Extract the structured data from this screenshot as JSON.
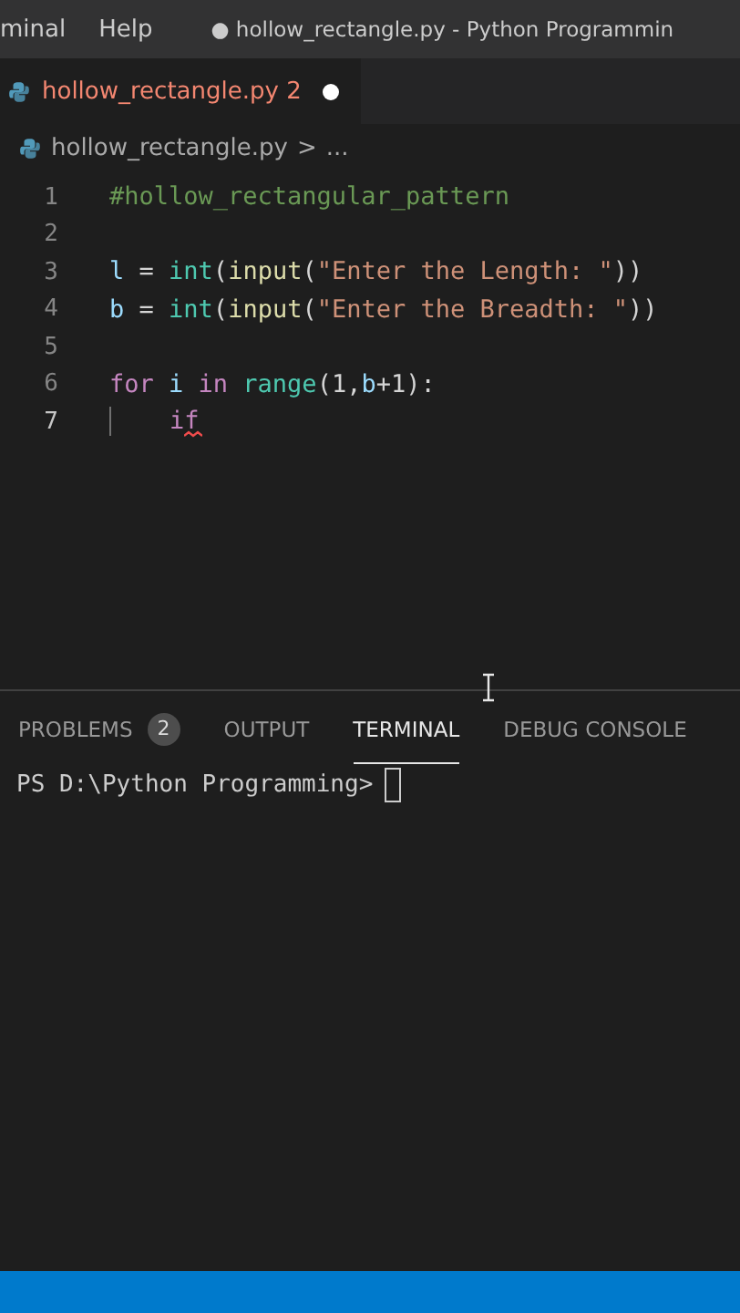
{
  "menu": [
    "minal",
    "Help"
  ],
  "window": {
    "modified_mark": "●",
    "title": "hollow_rectangle.py - Python Programmin"
  },
  "tabs": [
    {
      "label": "hollow_rectangle.py",
      "problems": "2",
      "modified": true,
      "selected": true
    }
  ],
  "breadcrumb": {
    "file": "hollow_rectangle.py",
    "separator": ">",
    "more": "..."
  },
  "code_lines": [
    {
      "number": "1",
      "tokens": [
        {
          "kind": "comment",
          "text": "#hollow_rectangular_pattern"
        }
      ]
    },
    {
      "number": "2"
    },
    {
      "number": "3",
      "tokens": [
        {
          "kind": "var",
          "text": "l"
        },
        {
          "kind": "plain",
          "text": " = "
        },
        {
          "kind": "func",
          "text": "int"
        },
        {
          "kind": "plain",
          "text": "("
        },
        {
          "kind": "builtin",
          "text": "input"
        },
        {
          "kind": "plain",
          "text": "("
        },
        {
          "kind": "string",
          "text": "\"Enter the Length: \""
        },
        {
          "kind": "plain",
          "text": "))"
        }
      ]
    },
    {
      "number": "4",
      "tokens": [
        {
          "kind": "var",
          "text": "b"
        },
        {
          "kind": "plain",
          "text": " = "
        },
        {
          "kind": "func",
          "text": "int"
        },
        {
          "kind": "plain",
          "text": "("
        },
        {
          "kind": "builtin",
          "text": "input"
        },
        {
          "kind": "plain",
          "text": "("
        },
        {
          "kind": "string",
          "text": "\"Enter the Breadth: \""
        },
        {
          "kind": "plain",
          "text": "))"
        }
      ]
    },
    {
      "number": "5"
    },
    {
      "number": "6",
      "tokens": [
        {
          "kind": "keyword",
          "text": "for"
        },
        {
          "kind": "var",
          "text": " i"
        },
        {
          "kind": "keyword",
          "text": " in"
        },
        {
          "kind": "func",
          "text": " range"
        },
        {
          "kind": "plain",
          "text": "(1,"
        },
        {
          "kind": "var",
          "text": "b"
        },
        {
          "kind": "plain",
          "text": "+1):"
        }
      ]
    },
    {
      "number": "7",
      "current": true,
      "error": true,
      "guide": true,
      "tokens": [
        {
          "kind": "keyword",
          "text": "if"
        }
      ]
    }
  ],
  "panel_tabs": [
    {
      "label": "PROBLEMS",
      "badge": "2",
      "selected": false
    },
    {
      "label": "OUTPUT",
      "selected": false
    },
    {
      "label": "TERMINAL",
      "selected": true
    },
    {
      "label": "DEBUG CONSOLE",
      "selected": false
    }
  ],
  "terminal": {
    "prompt": "PS D:\\Python Programming>"
  }
}
